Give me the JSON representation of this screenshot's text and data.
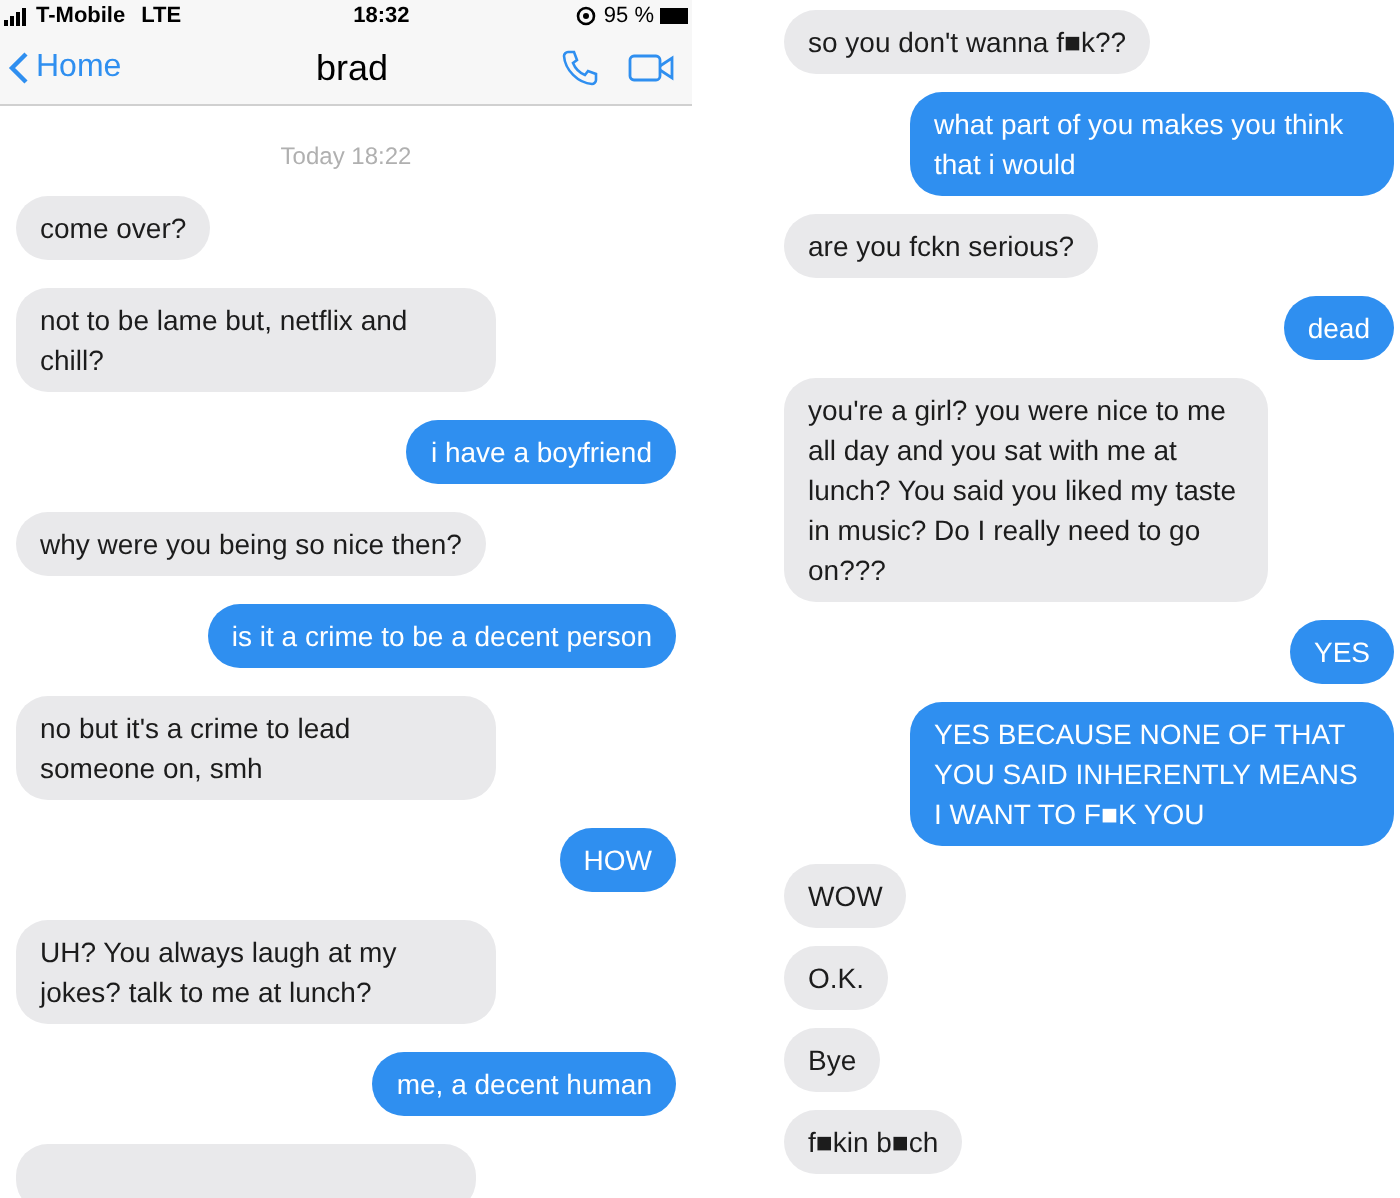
{
  "left_screen": {
    "status_bar": {
      "carrier": "T-Mobile",
      "network": "LTE",
      "time": "18:32",
      "battery": "95 %"
    },
    "nav": {
      "back": "Home",
      "title": "brad"
    },
    "timestamp": "Today 18:22",
    "messages": [
      {
        "kind": "received",
        "text": "come over?"
      },
      {
        "kind": "received",
        "text": "not to be lame but, netflix and chill?"
      },
      {
        "kind": "sent",
        "text": "i have a boyfriend"
      },
      {
        "kind": "received",
        "text": "why were you being so nice then?"
      },
      {
        "kind": "sent",
        "text": "is it a crime to be a decent person"
      },
      {
        "kind": "received",
        "text": "no but it's a crime to lead someone on, smh"
      },
      {
        "kind": "sent",
        "text": "HOW"
      },
      {
        "kind": "received",
        "text": "UH? You always laugh at my jokes? talk to me at lunch?"
      },
      {
        "kind": "sent",
        "text": "me, a decent human"
      },
      {
        "kind": "received"
      }
    ]
  },
  "right_screen": {
    "messages": [
      {
        "kind": "received",
        "text": "so you don't wanna f■k??"
      },
      {
        "kind": "sent",
        "text": "what part of you makes you think that i would"
      },
      {
        "kind": "received",
        "text": "are you fckn serious?"
      },
      {
        "kind": "sent",
        "text": "dead"
      },
      {
        "kind": "received",
        "text": "you're a girl? you were nice to me all day and you sat with me at lunch? You said you liked my taste in music? Do I really need to go on???"
      },
      {
        "kind": "sent",
        "text": "YES"
      },
      {
        "kind": "sent",
        "text": "YES BECAUSE NONE OF THAT YOU SAID INHERENTLY MEANS I WANT TO F■K YOU"
      },
      {
        "kind": "received",
        "text": "WOW"
      },
      {
        "kind": "received",
        "text": "O.K."
      },
      {
        "kind": "received",
        "text": "Bye"
      },
      {
        "kind": "received",
        "text": "f■kin b■ch"
      }
    ]
  }
}
